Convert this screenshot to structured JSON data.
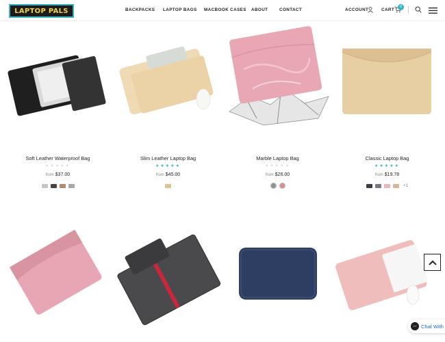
{
  "header": {
    "logo": "LAPTOP PALS",
    "nav": [
      "BACKPACKS",
      "LAPTOP BAGS",
      "MACBOOK CASES",
      "ABOUT",
      "CONTACT"
    ],
    "account_label": "ACCOUNT",
    "cart_label": "CART",
    "cart_count": "0"
  },
  "icons": {
    "account": "user-icon",
    "cart": "cart-icon",
    "search": "search-icon",
    "menu": "hamburger-menu-icon",
    "back_to_top": "chevron-up-icon",
    "chat": "messenger-icon"
  },
  "products": [
    {
      "name": "Soft Leather Waterproof Bag",
      "rating": 0,
      "price_prefix": "from",
      "price": "$37.00",
      "swatches": [
        "#c8c4c0",
        "#444444",
        "#b98a66",
        "#a8a8a8"
      ]
    },
    {
      "name": "Slim Leather Laptop Bag",
      "rating": 5,
      "price_prefix": "from",
      "price": "$45.00",
      "swatches": [
        "#e1c18e"
      ]
    },
    {
      "name": "Marble Laptop Bag",
      "rating": 0,
      "price_prefix": "from",
      "price": "$26.00",
      "swatches": [
        "#909497",
        "#d88c94"
      ]
    },
    {
      "name": "Classic Laptop Bag",
      "rating": 5,
      "price_prefix": "from",
      "price": "$19.78",
      "swatches": [
        "#3a3d44",
        "#757a84",
        "#e9b8bf",
        "#d9b48c"
      ],
      "more_label": "+1"
    }
  ],
  "chat": {
    "label": "Chat With Us"
  },
  "colors": {
    "accent": "#35b3c0",
    "star_empty": "#dcdcdc",
    "chat_text": "#1e6bd6"
  }
}
